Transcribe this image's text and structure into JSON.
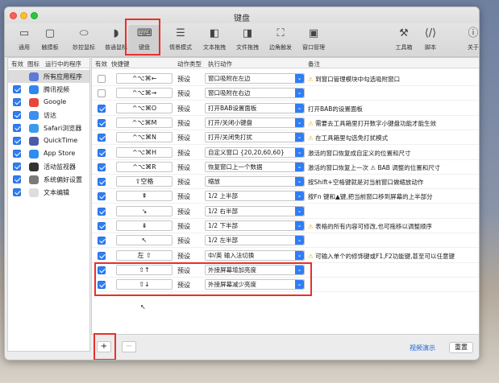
{
  "window": {
    "title": "键盘"
  },
  "toolbar": [
    {
      "label": "通用",
      "icon": "display-icon",
      "glyph": "▭"
    },
    {
      "label": "触摸板",
      "icon": "trackpad-icon",
      "glyph": "▢"
    },
    {
      "label": "妙控鼠标",
      "icon": "magic-mouse-icon",
      "glyph": "⬭"
    },
    {
      "label": "普通鼠标",
      "icon": "mouse-icon",
      "glyph": "◗"
    },
    {
      "label": "键盘",
      "icon": "keyboard-icon",
      "glyph": "⌨"
    },
    {
      "label": "情景模式",
      "icon": "sliders-icon",
      "glyph": "☰"
    },
    {
      "label": "文本拖拽",
      "icon": "text-drag-icon",
      "glyph": "◧"
    },
    {
      "label": "文件拖拽",
      "icon": "file-drag-icon",
      "glyph": "◨"
    },
    {
      "label": "边角触发",
      "icon": "corner-icon",
      "glyph": "⛶"
    },
    {
      "label": "窗口管理",
      "icon": "window-icon",
      "glyph": "▣"
    },
    {
      "label": "工具箱",
      "icon": "toolbox-icon",
      "glyph": "⚒"
    },
    {
      "label": "脚本",
      "icon": "script-icon",
      "glyph": "⟨/⟩"
    },
    {
      "label": "关于",
      "icon": "info-icon",
      "glyph": "ⓘ"
    }
  ],
  "apps_header": {
    "enabled": "有效",
    "icon": "图标",
    "name": "运行中的程序"
  },
  "apps": [
    {
      "name": "所有应用程序",
      "checked": null,
      "selected": true,
      "color": "#5d7bd6"
    },
    {
      "name": "腾讯视频",
      "checked": true,
      "color": "#2e86f0"
    },
    {
      "name": "Google",
      "checked": true,
      "color": "#e8463b"
    },
    {
      "name": "访达",
      "checked": true,
      "color": "#3d8ff0"
    },
    {
      "name": "Safari浏览器",
      "checked": true,
      "color": "#3a9be8"
    },
    {
      "name": "QuickTime",
      "checked": true,
      "color": "#4c5aa8"
    },
    {
      "name": "App Store",
      "checked": true,
      "color": "#2d8cf0"
    },
    {
      "name": "活动监视器",
      "checked": true,
      "color": "#333333"
    },
    {
      "name": "系统偏好设置",
      "checked": true,
      "color": "#7a7a7a"
    },
    {
      "name": "文本编辑",
      "checked": true,
      "color": "#dddddd"
    }
  ],
  "table_header": {
    "enabled": "有效",
    "key": "快捷键",
    "type": "动作类型",
    "action": "执行动作",
    "note": "备注"
  },
  "rows": [
    {
      "checked": false,
      "key": "^⌥⌘←",
      "type": "预设",
      "action": "窗口吸附在左边",
      "note": "到窗口管理模块中勾选吸附窗口",
      "warn": true
    },
    {
      "checked": false,
      "key": "^⌥⌘→",
      "type": "预设",
      "action": "窗口吸附在右边",
      "note": "",
      "warn": false
    },
    {
      "checked": true,
      "key": "^⌥⌘O",
      "type": "预设",
      "action": "打开BAB设置面板",
      "note": "打开BAB的设置面板",
      "warn": false
    },
    {
      "checked": true,
      "key": "^⌥⌘M",
      "type": "预设",
      "action": "打开/关闭小键盘",
      "note": "需要去工具箱里打开数字小键盘功能才能生效",
      "warn": true
    },
    {
      "checked": true,
      "key": "^⌥⌘N",
      "type": "预设",
      "action": "打开/关闭免打扰",
      "note": "在工具箱里勾选免打扰模式",
      "warn": true
    },
    {
      "checked": true,
      "key": "^⌥⌘H",
      "type": "预设",
      "action": "自定义窗口 {20,20,60,60}",
      "note": "激活的窗口恢复成自定义的位置和尺寸",
      "warn": false
    },
    {
      "checked": true,
      "key": "^⌥⌘R",
      "type": "预设",
      "action": "恢复窗口上一个数据",
      "note": "激活的窗口恢复上一次 ⚠ BAB 调整的位置和尺寸",
      "warn": false
    },
    {
      "checked": true,
      "key": "⇧空格",
      "type": "预设",
      "action": "缩放",
      "note": "按Shift+空格键就是对当前窗口做缩放动作",
      "warn": false
    },
    {
      "checked": true,
      "key": "⇞",
      "type": "预设",
      "action": "1/2 上半部",
      "note": "按Fn 键和▲键,把当前窗口移到屏幕的上半部分",
      "warn": false
    },
    {
      "checked": true,
      "key": "↘",
      "type": "预设",
      "action": "1/2 右半部",
      "note": "",
      "warn": false
    },
    {
      "checked": true,
      "key": "⇟",
      "type": "预设",
      "action": "1/2 下半部",
      "note": "表格的所有内容可修改,也可拖移以调整顺序",
      "warn": true
    },
    {
      "checked": true,
      "key": "↖",
      "type": "预设",
      "action": "1/2 左半部",
      "note": "",
      "warn": false
    },
    {
      "checked": true,
      "key": "左 ⇧",
      "type": "预设",
      "action": "中/英 输入法切换",
      "note": "可输入单个的修饰键或F1,F2功能键,甚至可以任意键",
      "warn": true
    },
    {
      "checked": true,
      "key": "⇧↑",
      "type": "预设",
      "action": "外接屏幕增加亮度",
      "note": "",
      "warn": false
    },
    {
      "checked": true,
      "key": "⇧↓",
      "type": "预设",
      "action": "外接屏幕减少亮度",
      "note": "",
      "warn": false
    }
  ],
  "footer": {
    "add": "+",
    "remove": "−",
    "video_link": "视频演示",
    "reset": "重置",
    "cursor_mark": "↖"
  },
  "colors": {
    "accent": "#2f7df6",
    "highlight_red": "#e8302a"
  }
}
